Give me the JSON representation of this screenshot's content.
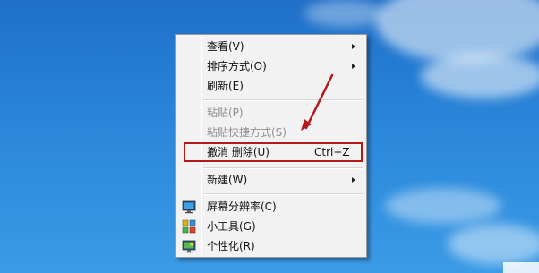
{
  "context_menu": {
    "items": [
      {
        "label": "查看(V)",
        "has_submenu": true,
        "disabled": false
      },
      {
        "label": "排序方式(O)",
        "has_submenu": true,
        "disabled": false
      },
      {
        "label": "刷新(E)",
        "has_submenu": false,
        "disabled": false
      },
      {
        "label": "粘贴(P)",
        "has_submenu": false,
        "disabled": true
      },
      {
        "label": "粘贴快捷方式(S)",
        "has_submenu": false,
        "disabled": true
      },
      {
        "label": "撤消 删除(U)",
        "shortcut": "Ctrl+Z",
        "has_submenu": false,
        "disabled": false,
        "highlighted": true
      },
      {
        "label": "新建(W)",
        "has_submenu": true,
        "disabled": false
      },
      {
        "label": "屏幕分辨率(C)",
        "icon": "monitor-icon",
        "has_submenu": false,
        "disabled": false
      },
      {
        "label": "小工具(G)",
        "icon": "gadgets-icon",
        "has_submenu": false,
        "disabled": false
      },
      {
        "label": "个性化(R)",
        "icon": "personalize-icon",
        "has_submenu": false,
        "disabled": false
      }
    ]
  },
  "annotation": {
    "box_color": "#b51a1a",
    "arrow_color": "#b51a1a"
  },
  "colors": {
    "desktop_top": "#1f6fc8",
    "desktop_bottom": "#3a9be6",
    "menu_background": "#f2f2f2",
    "disabled_text": "#8e8e8e"
  }
}
